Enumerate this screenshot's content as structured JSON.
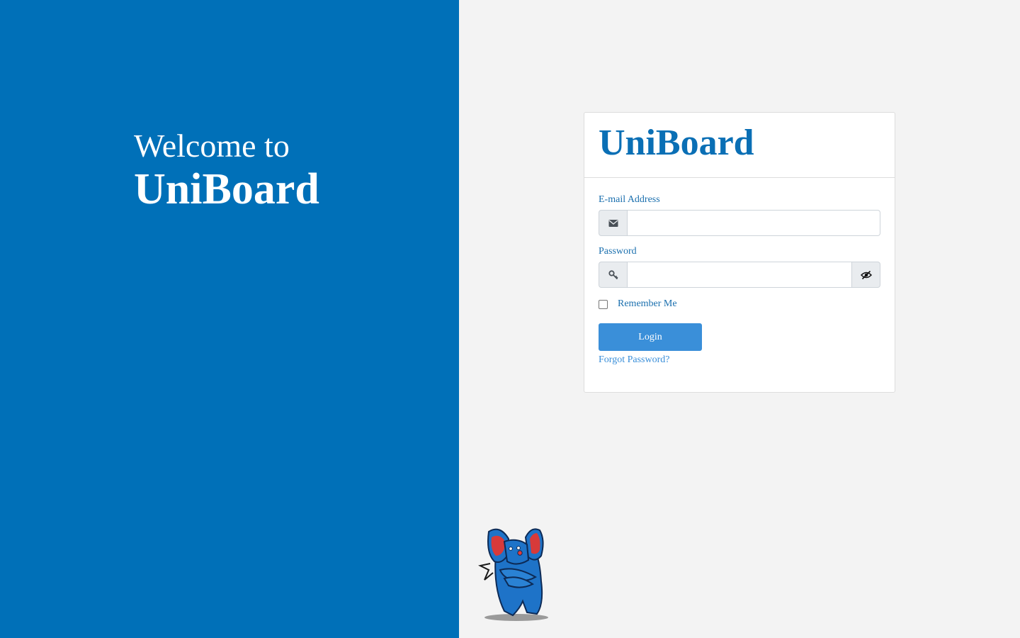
{
  "hero": {
    "welcome_line": "Welcome to",
    "brand": "UniBoard"
  },
  "card": {
    "title": "UniBoard",
    "email": {
      "label": "E-mail Address",
      "value": "",
      "placeholder": "",
      "icon": "envelope-icon"
    },
    "password": {
      "label": "Password",
      "value": "",
      "placeholder": "",
      "icon": "key-icon",
      "toggle_icon": "eye-slash-icon"
    },
    "remember": {
      "label": "Remember Me",
      "checked": false
    },
    "login_label": "Login",
    "forgot_label": "Forgot Password?"
  },
  "colors": {
    "left_panel": "#0070b8",
    "brand_text": "#0a6fb5",
    "button": "#3a8fd9",
    "background": "#f3f3f3"
  }
}
